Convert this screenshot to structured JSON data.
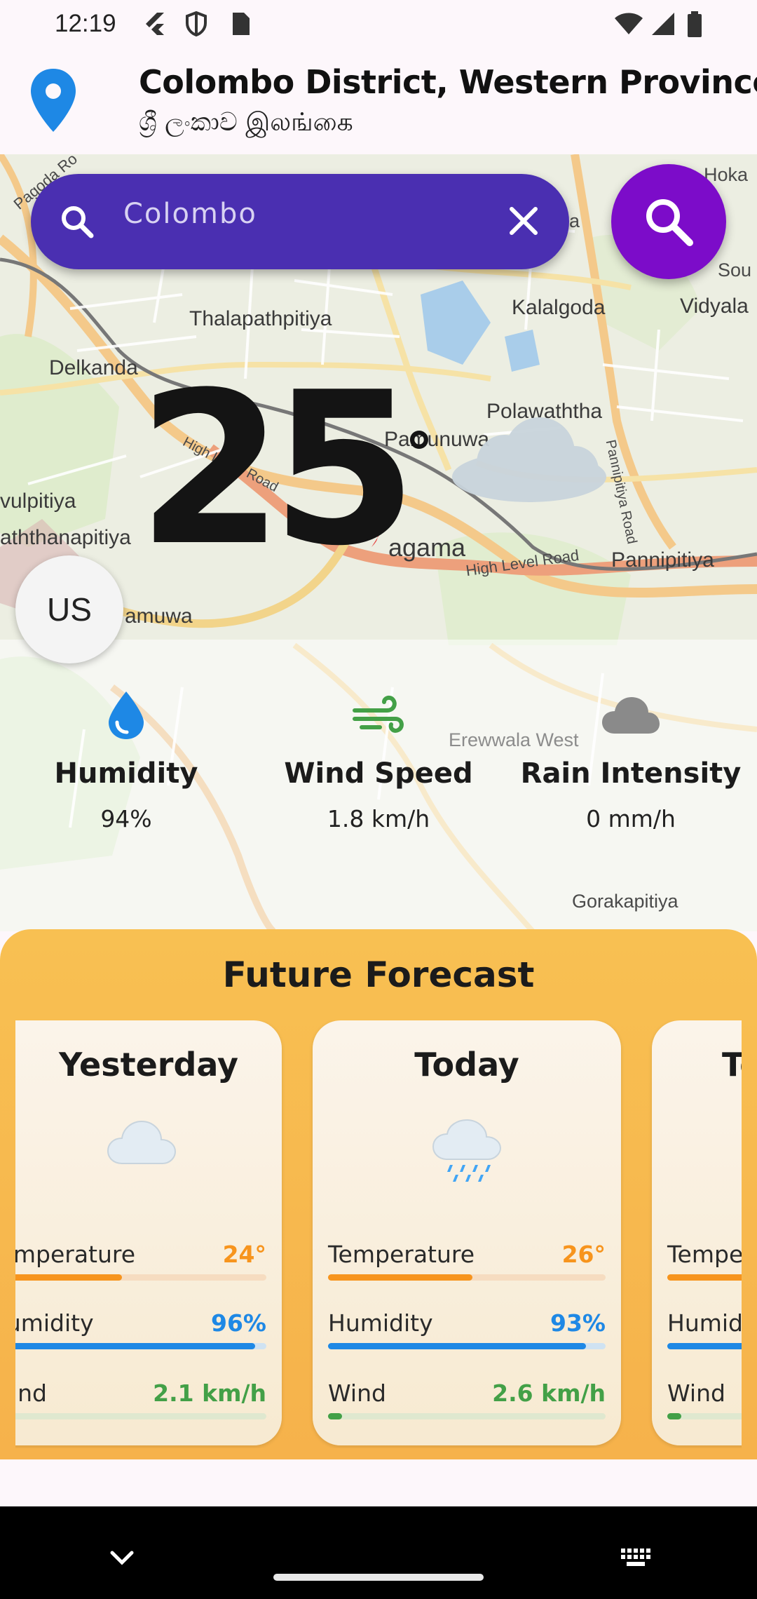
{
  "status_bar": {
    "time": "12:19",
    "icons": [
      "flutter-icon",
      "shield-icon",
      "sim-card-icon",
      "wifi-icon",
      "signal-icon",
      "battery-icon"
    ]
  },
  "header": {
    "location_title": "Colombo District, Western Province",
    "location_subtitle": "ශ්‍රී ලංකාව இலங்கை",
    "pin_icon": "location-pin-icon"
  },
  "map": {
    "labels": [
      "Thalapathpitiya",
      "Kalalgoda",
      "Vidyala",
      "Delkanda",
      "Polawaththa",
      "Pamunuwa",
      "vulpitiya",
      "aththanapitiya",
      "agama",
      "Pannipitiya",
      "High Level Road",
      "amuwa",
      "Erewwala West",
      "Gorakapitiya",
      "Hoka",
      "Sou",
      "a",
      "Pagoda Ro",
      "Pannipitiya Road",
      "High Le",
      "Road"
    ]
  },
  "search": {
    "query": "Colombo",
    "search_icon": "search-icon",
    "clear_icon": "close-icon",
    "fab_icon": "search-icon"
  },
  "current": {
    "temperature": "25",
    "degree_symbol": "°",
    "condition_icon": "cloud-icon",
    "unit_toggle": "US"
  },
  "stats": [
    {
      "icon": "water-drop-icon",
      "label": "Humidity",
      "value": "94%"
    },
    {
      "icon": "wind-icon",
      "label": "Wind Speed",
      "value": "1.8 km/h"
    },
    {
      "icon": "cloud-icon",
      "label": "Rain Intensity",
      "value": "0 mm/h"
    }
  ],
  "forecast": {
    "title": "Future Forecast",
    "cards": [
      {
        "day": "Yesterday",
        "icon": "cloud-icon",
        "rows": [
          {
            "label": "Temperature",
            "value": "24°",
            "progress": 0.48
          },
          {
            "label": "Humidity",
            "value": "96%",
            "progress": 0.96
          },
          {
            "label": "Wind",
            "value": "2.1 km/h",
            "progress": 0.05
          }
        ]
      },
      {
        "day": "Today",
        "icon": "rain-cloud-icon",
        "rows": [
          {
            "label": "Temperature",
            "value": "26°",
            "progress": 0.52
          },
          {
            "label": "Humidity",
            "value": "93%",
            "progress": 0.93
          },
          {
            "label": "Wind",
            "value": "2.6 km/h",
            "progress": 0.05
          }
        ]
      },
      {
        "day": "Tomorrow",
        "icon": "cloud-icon",
        "rows": [
          {
            "label": "Temperature",
            "value": "",
            "progress": 0.5
          },
          {
            "label": "Humidity",
            "value": "",
            "progress": 0.9
          },
          {
            "label": "Wind",
            "value": "",
            "progress": 0.05
          }
        ]
      }
    ]
  },
  "colors": {
    "search_bar": "#4a2fb1",
    "search_fab": "#7c0cc9",
    "temperature_accent": "#f7941d",
    "humidity_accent": "#1e88e5",
    "wind_accent": "#43a047",
    "forecast_bg": "#f6b24b"
  },
  "nav_bar": {
    "back_icon": "chevron-down-icon",
    "keyboard_icon": "keyboard-icon"
  }
}
